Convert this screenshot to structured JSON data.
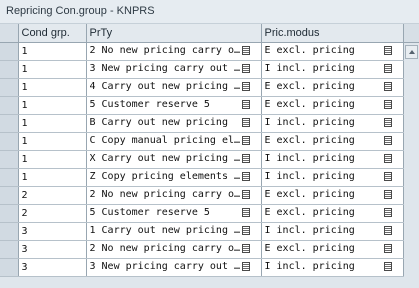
{
  "window": {
    "title": "Repricing Con.group - KNPRS"
  },
  "columns": [
    "Cond grp.",
    "PrTy",
    "Pric.modus"
  ],
  "rows": [
    {
      "cond_grp": "1",
      "prty": "2 No new pricing carry o…",
      "pric": "E excl. pricing"
    },
    {
      "cond_grp": "1",
      "prty": "3 New pricing carry out …",
      "pric": "I incl. pricing"
    },
    {
      "cond_grp": "1",
      "prty": "4 Carry out new pricing …",
      "pric": "E excl. pricing"
    },
    {
      "cond_grp": "1",
      "prty": "5 Customer reserve 5",
      "pric": "E excl. pricing"
    },
    {
      "cond_grp": "1",
      "prty": "B Carry out new pricing",
      "pric": "I incl. pricing"
    },
    {
      "cond_grp": "1",
      "prty": "C Copy manual pricing el…",
      "pric": "E excl. pricing"
    },
    {
      "cond_grp": "1",
      "prty": "X Carry out new pricing …",
      "pric": "I incl. pricing"
    },
    {
      "cond_grp": "1",
      "prty": "Z Copy pricing elements …",
      "pric": "I incl. pricing"
    },
    {
      "cond_grp": "2",
      "prty": "2 No new pricing carry o…",
      "pric": "E excl. pricing"
    },
    {
      "cond_grp": "2",
      "prty": "5 Customer reserve 5",
      "pric": "E excl. pricing"
    },
    {
      "cond_grp": "3",
      "prty": "1 Carry out new pricing …",
      "pric": "I incl. pricing"
    },
    {
      "cond_grp": "3",
      "prty": "2 No new pricing carry o…",
      "pric": "E excl. pricing"
    },
    {
      "cond_grp": "3",
      "prty": "3 New pricing carry out …",
      "pric": "I incl. pricing"
    }
  ]
}
